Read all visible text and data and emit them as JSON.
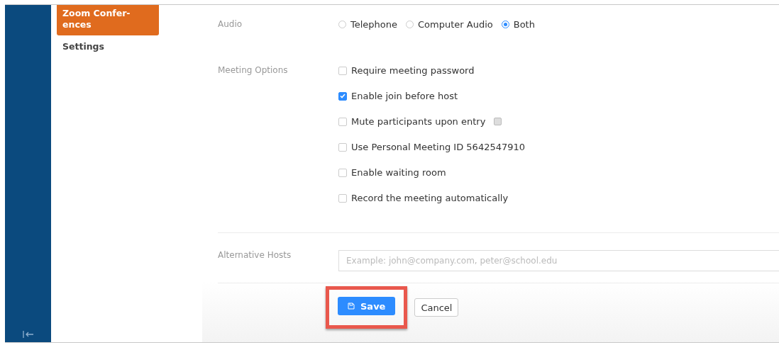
{
  "sidebar": {
    "items": [
      {
        "label": "Zoom Confer-\nences",
        "selected": true
      },
      {
        "label": "Settings",
        "selected": false
      }
    ]
  },
  "audio": {
    "label": "Audio",
    "options": [
      {
        "label": "Telephone",
        "selected": false
      },
      {
        "label": "Computer Audio",
        "selected": false
      },
      {
        "label": "Both",
        "selected": true
      }
    ]
  },
  "meeting_options": {
    "label": "Meeting Options",
    "options": [
      {
        "label": "Require meeting password",
        "checked": false,
        "info": false
      },
      {
        "label": "Enable join before host",
        "checked": true,
        "info": false
      },
      {
        "label": "Mute participants upon entry",
        "checked": false,
        "info": true
      },
      {
        "label": "Use Personal Meeting ID 5642547910",
        "checked": false,
        "info": false
      },
      {
        "label": "Enable waiting room",
        "checked": false,
        "info": false
      },
      {
        "label": "Record the meeting automatically",
        "checked": false,
        "info": false
      }
    ]
  },
  "alternative_hosts": {
    "label": "Alternative Hosts",
    "placeholder": "Example: john@company.com, peter@school.edu"
  },
  "buttons": {
    "save": "Save",
    "cancel": "Cancel",
    "save_highlighted": true
  }
}
